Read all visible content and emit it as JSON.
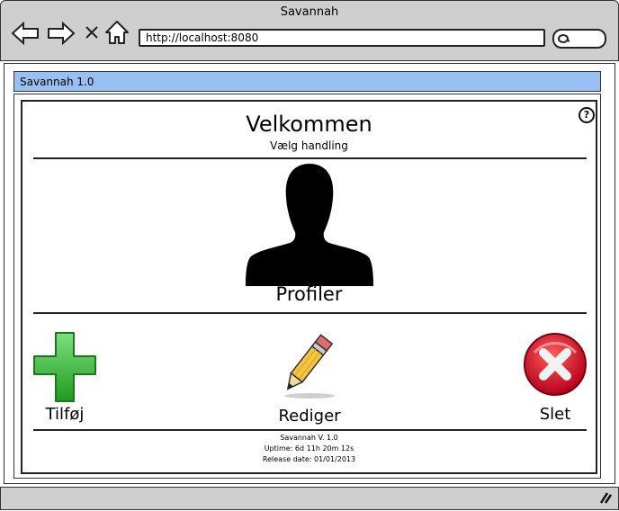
{
  "browser": {
    "title": "Savannah",
    "url": "http://localhost:8080",
    "back_icon": "back-arrow-icon",
    "forward_icon": "forward-arrow-icon",
    "stop_icon": "close-icon",
    "home_icon": "home-icon",
    "search_icon": "search-icon"
  },
  "app": {
    "bar_title": "Savannah 1.0"
  },
  "main": {
    "title": "Velkommen",
    "subtitle": "Vælg handling",
    "profile_label": "Profiler",
    "help_label": "?"
  },
  "actions": {
    "add_label": "Tilføj",
    "edit_label": "Rediger",
    "delete_label": "Slet"
  },
  "footer": {
    "version": "Savannah V. 1.0",
    "uptime": "Uptime: 6d 11h 20m 12s",
    "release": "Release date: 01/01/2013"
  },
  "colors": {
    "app_bar": "#99c0f2",
    "chrome": "#cfcfcf",
    "add_icon": "#3fbf3f",
    "delete_icon": "#cc1a2a"
  }
}
